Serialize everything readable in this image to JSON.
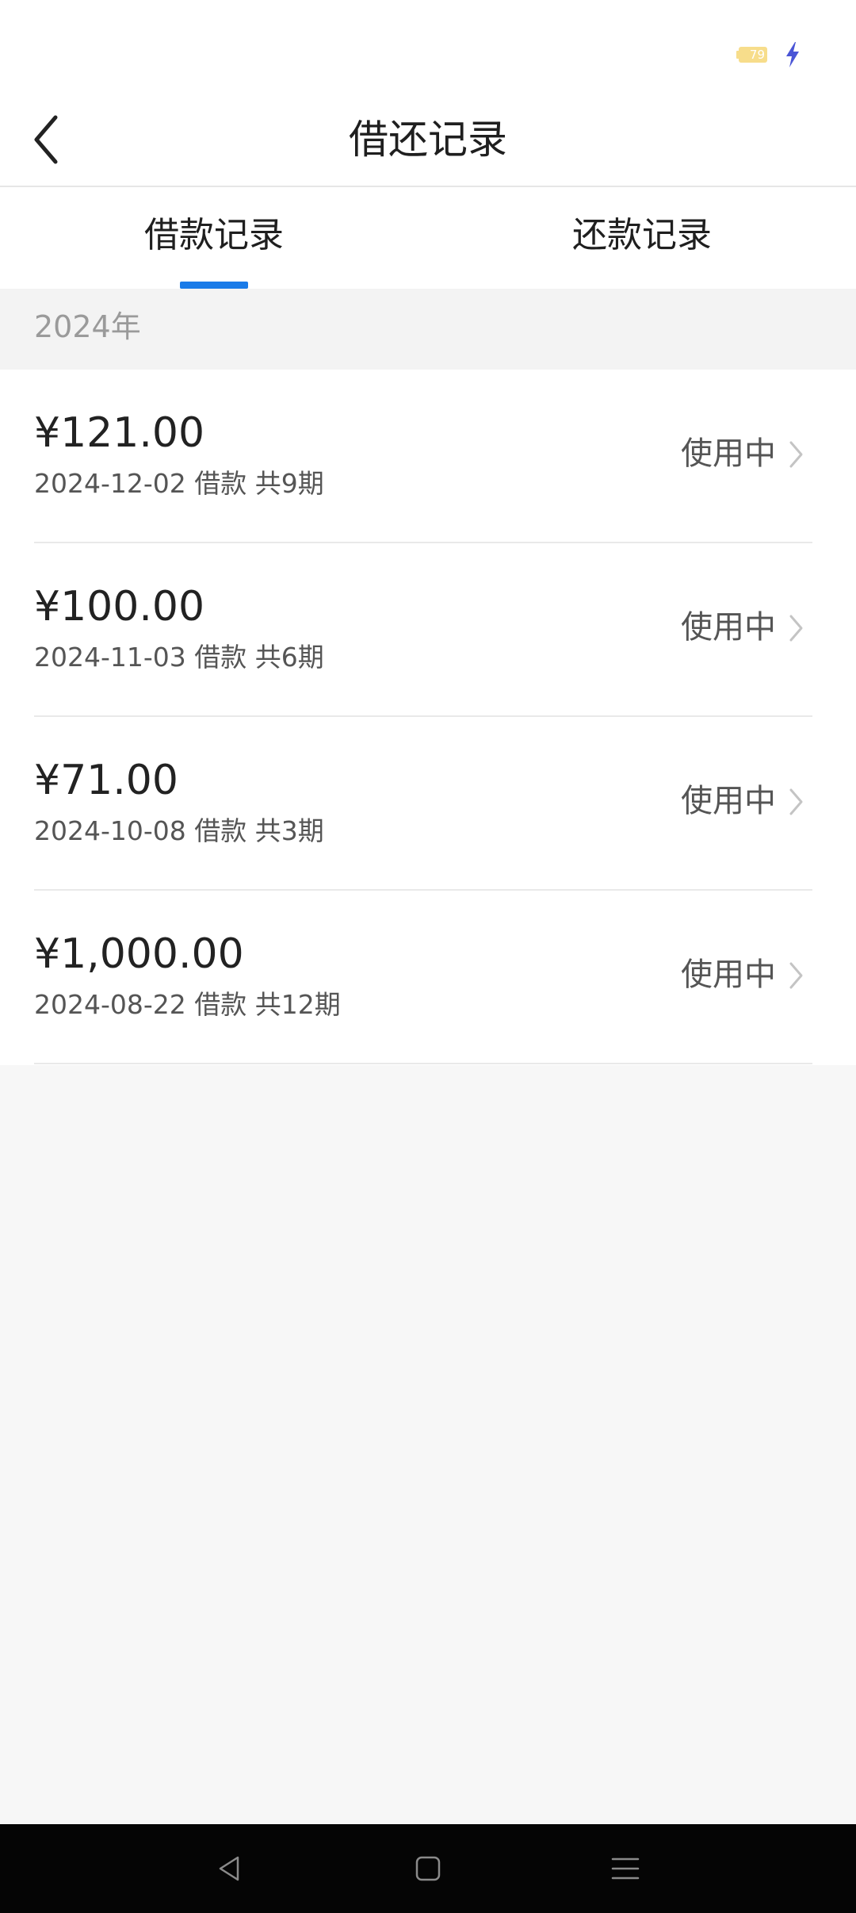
{
  "status_bar": {
    "battery_level": "79",
    "battery_color": "#f7dd8b",
    "charge_icon": "lightning-icon",
    "charge_color": "#4a55d6"
  },
  "header": {
    "title": "借还记录",
    "back_icon": "chevron-left-icon"
  },
  "tabs": {
    "items": [
      {
        "label": "借款记录",
        "active": true
      },
      {
        "label": "还款记录",
        "active": false
      }
    ],
    "accent_color": "#1a7be8"
  },
  "year_group": {
    "label": "2024年"
  },
  "records": [
    {
      "amount": "¥121.00",
      "meta": "2024-12-02 借款 共9期",
      "status": "使用中"
    },
    {
      "amount": "¥100.00",
      "meta": "2024-11-03 借款 共6期",
      "status": "使用中"
    },
    {
      "amount": "¥71.00",
      "meta": "2024-10-08 借款 共3期",
      "status": "使用中"
    },
    {
      "amount": "¥1,000.00",
      "meta": "2024-08-22 借款 共12期",
      "status": "使用中"
    }
  ],
  "nav_bar": {
    "back_icon": "triangle-back-icon",
    "home_icon": "square-home-icon",
    "menu_icon": "menu-lines-icon"
  }
}
